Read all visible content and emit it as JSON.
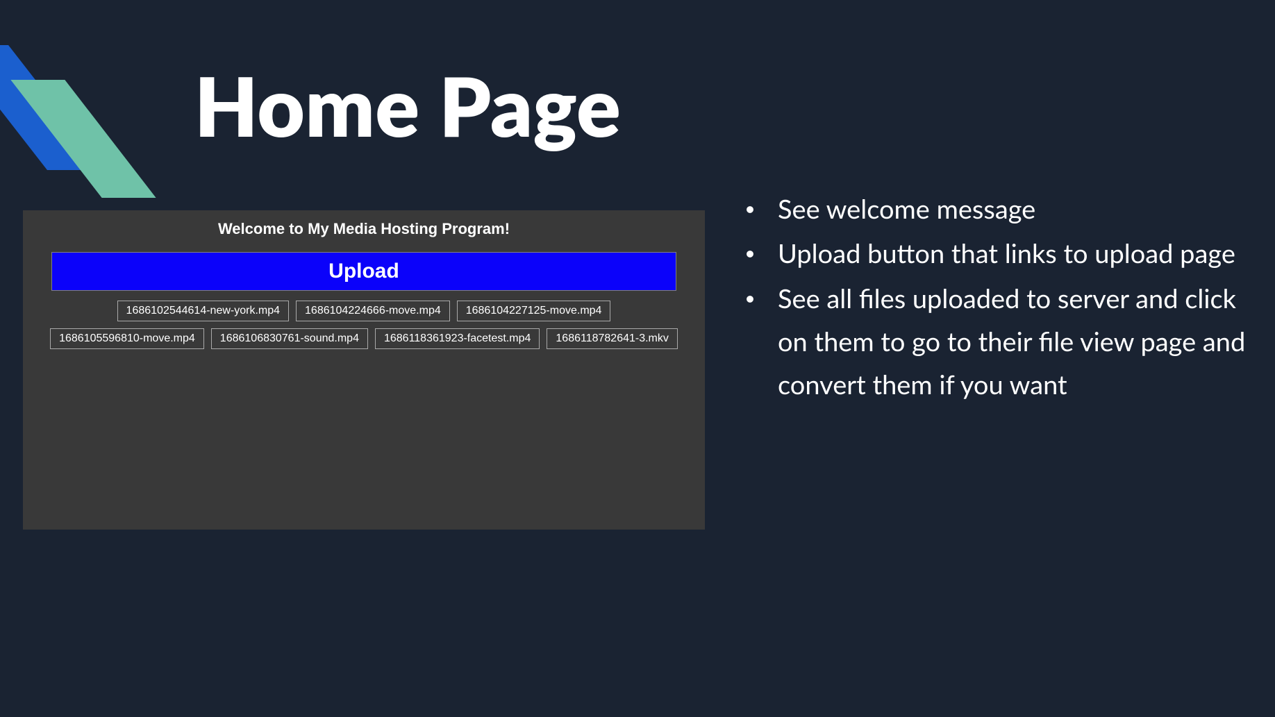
{
  "slide": {
    "title": "Home Page"
  },
  "app": {
    "welcome": "Welcome to My Media Hosting Program!",
    "upload_label": "Upload",
    "files": [
      "1686102544614-new-york.mp4",
      "1686104224666-move.mp4",
      "1686104227125-move.mp4",
      "1686105596810-move.mp4",
      "1686106830761-sound.mp4",
      "1686118361923-facetest.mp4",
      "1686118782641-3.mkv"
    ]
  },
  "bullets": [
    "See welcome message",
    "Upload button that links to upload page",
    "See all files uploaded to server and click on them to go to their file view page and convert them if you want"
  ]
}
